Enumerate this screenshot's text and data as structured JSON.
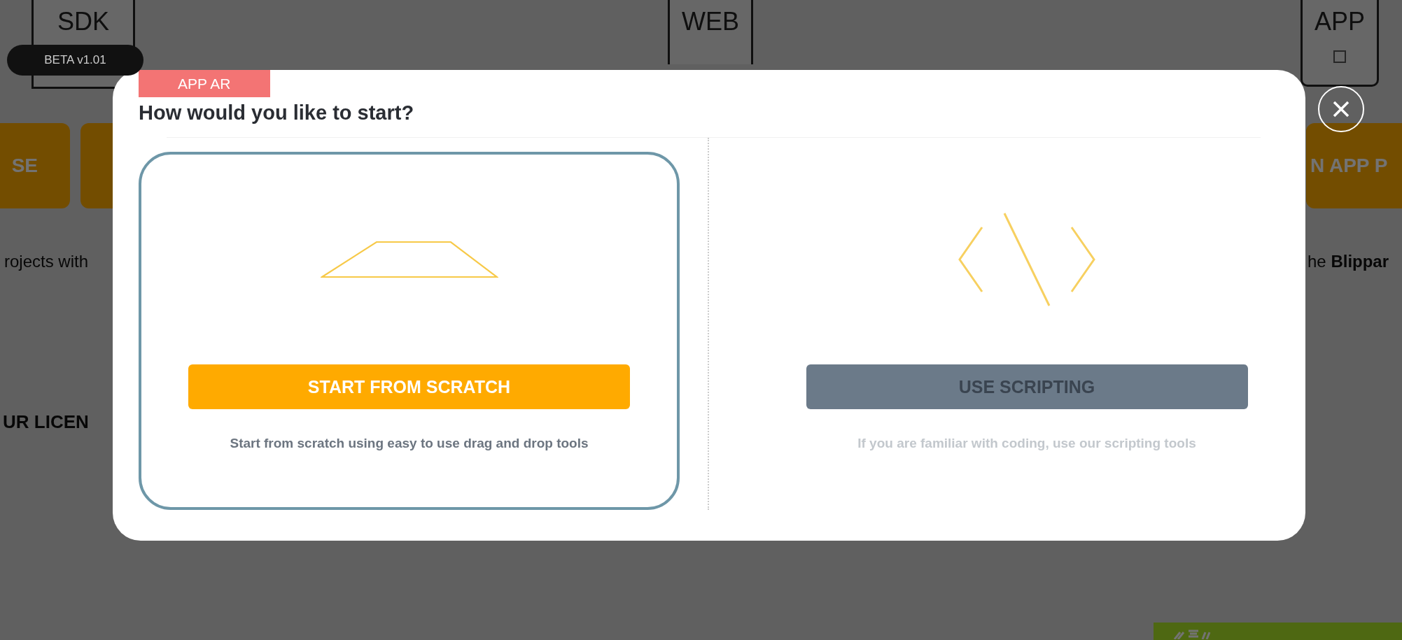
{
  "background": {
    "platform_tiles": [
      {
        "kind": "sdk",
        "label": "SDK"
      },
      {
        "kind": "web",
        "label": "WEB"
      },
      {
        "kind": "app",
        "label": "APP"
      }
    ],
    "beta_badge": "BETA v1.01",
    "action_tiles": [
      "SE",
      "N APP P"
    ],
    "intro_left": "rojects with",
    "intro_right": "he **Blippar**",
    "license_heading": "UR LICEN"
  },
  "modal": {
    "tag": "APP AR",
    "title": "How would you like to start?",
    "options": [
      {
        "kind": "scratch",
        "selected": true,
        "button": "START FROM SCRATCH",
        "description": "Start from scratch using easy to use drag and drop tools"
      },
      {
        "kind": "scripting",
        "selected": false,
        "button": "USE SCRIPTING",
        "description": "If you are familiar with coding, use our scripting tools"
      }
    ]
  }
}
